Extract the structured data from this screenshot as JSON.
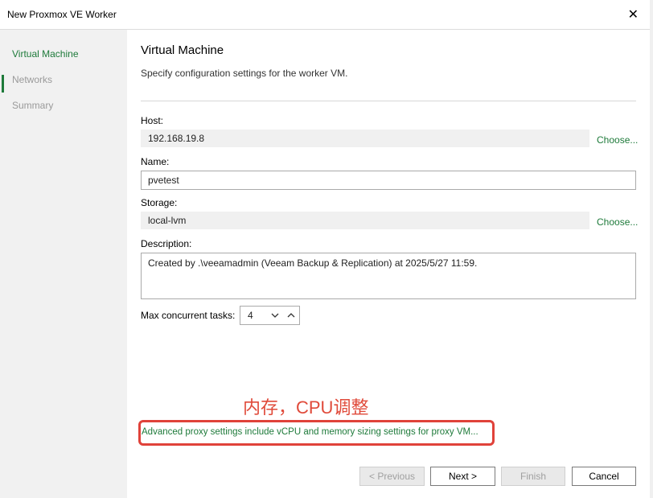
{
  "window": {
    "title": "New Proxmox VE Worker",
    "close_icon": "close-icon"
  },
  "sidebar": {
    "items": [
      {
        "label": "Virtual Machine",
        "active": true
      },
      {
        "label": "Networks",
        "active": false
      },
      {
        "label": "Summary",
        "active": false
      }
    ],
    "accent_color": "#1e7a3a"
  },
  "main": {
    "title": "Virtual Machine",
    "subtitle": "Specify configuration settings for the worker VM.",
    "host": {
      "label": "Host:",
      "value": "192.168.19.8",
      "link": "Choose..."
    },
    "name": {
      "label": "Name:",
      "value": "pvetest"
    },
    "storage": {
      "label": "Storage:",
      "value": "local-lvm",
      "link": "Choose..."
    },
    "description": {
      "label": "Description:",
      "value": "Created by .\\veeamadmin (Veeam Backup & Replication) at 2025/5/27 11:59."
    },
    "max_tasks": {
      "label": "Max concurrent tasks:",
      "value": "4"
    },
    "annotation": "内存，CPU调整",
    "advanced_link": "Advanced proxy settings include vCPU and memory sizing settings for proxy VM..."
  },
  "buttons": {
    "previous": "< Previous",
    "next": "Next >",
    "finish": "Finish",
    "cancel": "Cancel"
  }
}
